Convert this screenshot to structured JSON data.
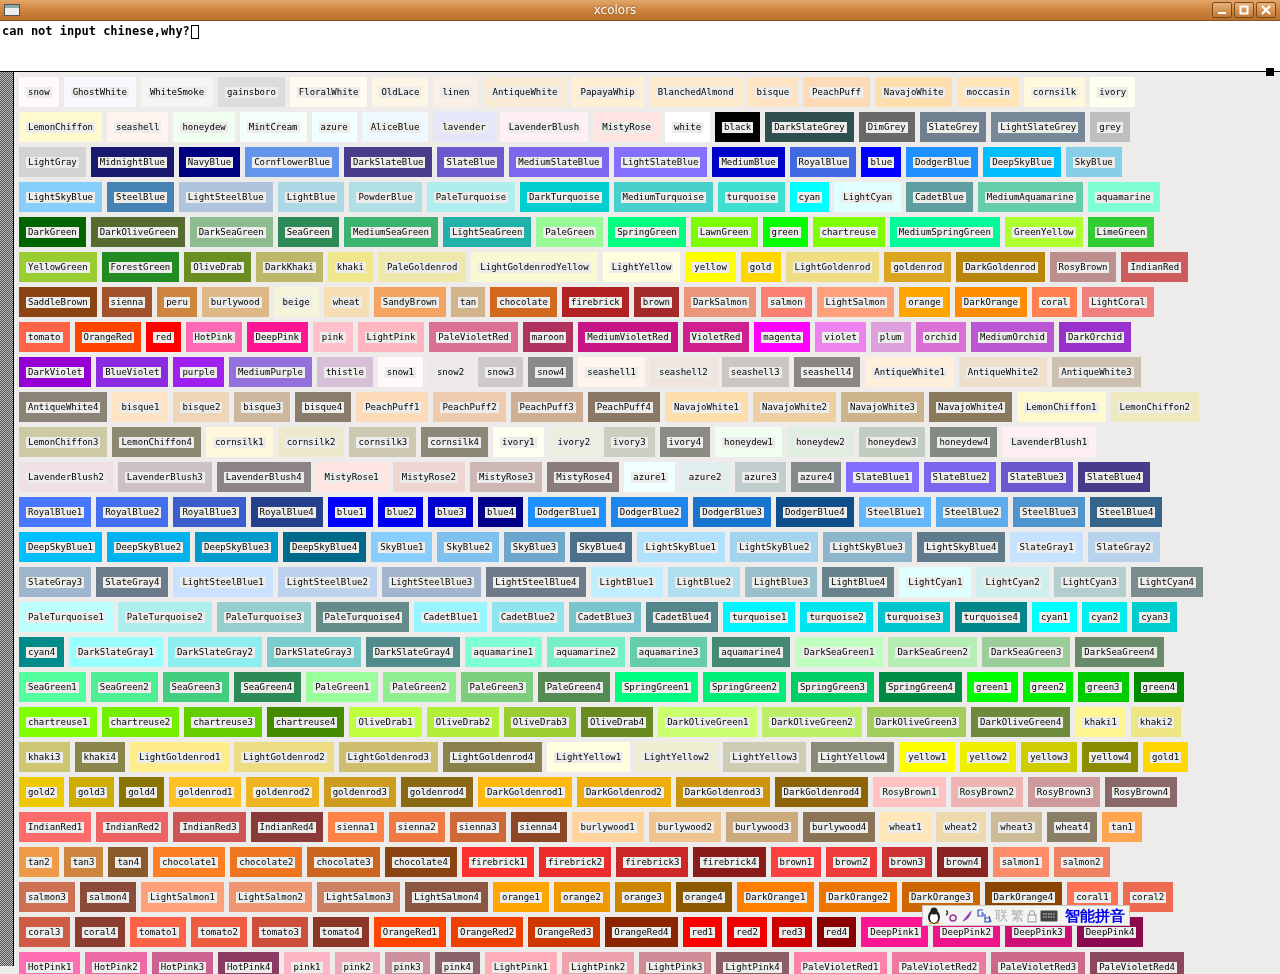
{
  "window": {
    "title": "xcolors"
  },
  "editor": {
    "text": "can not input chinese,why?"
  },
  "rows": [
    [
      {
        "name": "snow",
        "color": "#fffafa"
      },
      {
        "name": "GhostWhite",
        "color": "#f8f8ff"
      },
      {
        "name": "WhiteSmoke",
        "color": "#f5f5f5"
      },
      {
        "name": "gainsboro",
        "color": "#dcdcdc"
      },
      {
        "name": "FloralWhite",
        "color": "#fffaf0"
      },
      {
        "name": "OldLace",
        "color": "#fdf5e6"
      },
      {
        "name": "linen",
        "color": "#faf0e6"
      },
      {
        "name": "AntiqueWhite",
        "color": "#faebd7"
      },
      {
        "name": "PapayaWhip",
        "color": "#ffefd5"
      },
      {
        "name": "BlanchedAlmond",
        "color": "#ffebcd"
      },
      {
        "name": "bisque",
        "color": "#ffe4c4"
      },
      {
        "name": "PeachPuff",
        "color": "#ffdab9"
      },
      {
        "name": "NavajoWhite",
        "color": "#ffdead"
      },
      {
        "name": "moccasin",
        "color": "#ffe4b5"
      },
      {
        "name": "cornsilk",
        "color": "#fff8dc"
      },
      {
        "name": "ivory",
        "color": "#fffff0"
      }
    ],
    [
      {
        "name": "LemonChiffon",
        "color": "#fffacd"
      },
      {
        "name": "seashell",
        "color": "#fff5ee"
      },
      {
        "name": "honeydew",
        "color": "#f0fff0"
      },
      {
        "name": "MintCream",
        "color": "#f5fffa"
      },
      {
        "name": "azure",
        "color": "#f0ffff"
      },
      {
        "name": "AliceBlue",
        "color": "#f0f8ff"
      },
      {
        "name": "lavender",
        "color": "#e6e6fa"
      },
      {
        "name": "LavenderBlush",
        "color": "#fff0f5"
      },
      {
        "name": "MistyRose",
        "color": "#ffe4e1"
      },
      {
        "name": "white",
        "color": "#ffffff"
      },
      {
        "name": "black",
        "color": "#000000"
      },
      {
        "name": "DarkSlateGrey",
        "color": "#2f4f4f"
      },
      {
        "name": "DimGrey",
        "color": "#696969"
      },
      {
        "name": "SlateGrey",
        "color": "#708090"
      },
      {
        "name": "LightSlateGrey",
        "color": "#778899"
      },
      {
        "name": "grey",
        "color": "#bebebe"
      }
    ],
    [
      {
        "name": "LightGray",
        "color": "#d3d3d3"
      },
      {
        "name": "MidnightBlue",
        "color": "#191970"
      },
      {
        "name": "NavyBlue",
        "color": "#000080"
      },
      {
        "name": "CornflowerBlue",
        "color": "#6495ed"
      },
      {
        "name": "DarkSlateBlue",
        "color": "#483d8b"
      },
      {
        "name": "SlateBlue",
        "color": "#6a5acd"
      },
      {
        "name": "MediumSlateBlue",
        "color": "#7b68ee"
      },
      {
        "name": "LightSlateBlue",
        "color": "#8470ff"
      },
      {
        "name": "MediumBlue",
        "color": "#0000cd"
      },
      {
        "name": "RoyalBlue",
        "color": "#4169e1"
      },
      {
        "name": "blue",
        "color": "#0000ff"
      },
      {
        "name": "DodgerBlue",
        "color": "#1e90ff"
      },
      {
        "name": "DeepSkyBlue",
        "color": "#00bfff"
      },
      {
        "name": "SkyBlue",
        "color": "#87ceeb"
      }
    ],
    [
      {
        "name": "LightSkyBlue",
        "color": "#87cefa"
      },
      {
        "name": "SteelBlue",
        "color": "#4682b4"
      },
      {
        "name": "LightSteelBlue",
        "color": "#b0c4de"
      },
      {
        "name": "LightBlue",
        "color": "#add8e6"
      },
      {
        "name": "PowderBlue",
        "color": "#b0e0e6"
      },
      {
        "name": "PaleTurquoise",
        "color": "#afeeee"
      },
      {
        "name": "DarkTurquoise",
        "color": "#00ced1"
      },
      {
        "name": "MediumTurquoise",
        "color": "#48d1cc"
      },
      {
        "name": "turquoise",
        "color": "#40e0d0"
      },
      {
        "name": "cyan",
        "color": "#00ffff"
      },
      {
        "name": "LightCyan",
        "color": "#e0ffff"
      },
      {
        "name": "CadetBlue",
        "color": "#5f9ea0"
      },
      {
        "name": "MediumAquamarine",
        "color": "#66cdaa"
      },
      {
        "name": "aquamarine",
        "color": "#7fffd4"
      }
    ],
    [
      {
        "name": "DarkGreen",
        "color": "#006400"
      },
      {
        "name": "DarkOliveGreen",
        "color": "#556b2f"
      },
      {
        "name": "DarkSeaGreen",
        "color": "#8fbc8f"
      },
      {
        "name": "SeaGreen",
        "color": "#2e8b57"
      },
      {
        "name": "MediumSeaGreen",
        "color": "#3cb371"
      },
      {
        "name": "LightSeaGreen",
        "color": "#20b2aa"
      },
      {
        "name": "PaleGreen",
        "color": "#98fb98"
      },
      {
        "name": "SpringGreen",
        "color": "#00ff7f"
      },
      {
        "name": "LawnGreen",
        "color": "#7cfc00"
      },
      {
        "name": "green",
        "color": "#00ff00"
      },
      {
        "name": "chartreuse",
        "color": "#7fff00"
      },
      {
        "name": "MediumSpringGreen",
        "color": "#00fa9a"
      },
      {
        "name": "GreenYellow",
        "color": "#adff2f"
      },
      {
        "name": "LimeGreen",
        "color": "#32cd32"
      }
    ],
    [
      {
        "name": "YellowGreen",
        "color": "#9acd32"
      },
      {
        "name": "ForestGreen",
        "color": "#228b22"
      },
      {
        "name": "OliveDrab",
        "color": "#6b8e23"
      },
      {
        "name": "DarkKhaki",
        "color": "#bdb76b"
      },
      {
        "name": "khaki",
        "color": "#f0e68c"
      },
      {
        "name": "PaleGoldenrod",
        "color": "#eee8aa"
      },
      {
        "name": "LightGoldenrodYellow",
        "color": "#fafad2"
      },
      {
        "name": "LightYellow",
        "color": "#ffffe0"
      },
      {
        "name": "yellow",
        "color": "#ffff00"
      },
      {
        "name": "gold",
        "color": "#ffd700"
      },
      {
        "name": "LightGoldenrod",
        "color": "#eedd82"
      },
      {
        "name": "goldenrod",
        "color": "#daa520"
      },
      {
        "name": "DarkGoldenrod",
        "color": "#b8860b"
      },
      {
        "name": "RosyBrown",
        "color": "#bc8f8f"
      },
      {
        "name": "IndianRed",
        "color": "#cd5c5c"
      }
    ],
    [
      {
        "name": "SaddleBrown",
        "color": "#8b4513"
      },
      {
        "name": "sienna",
        "color": "#a0522d"
      },
      {
        "name": "peru",
        "color": "#cd853f"
      },
      {
        "name": "burlywood",
        "color": "#deb887"
      },
      {
        "name": "beige",
        "color": "#f5f5dc"
      },
      {
        "name": "wheat",
        "color": "#f5deb3"
      },
      {
        "name": "SandyBrown",
        "color": "#f4a460"
      },
      {
        "name": "tan",
        "color": "#d2b48c"
      },
      {
        "name": "chocolate",
        "color": "#d2691e"
      },
      {
        "name": "firebrick",
        "color": "#b22222"
      },
      {
        "name": "brown",
        "color": "#a52a2a"
      },
      {
        "name": "DarkSalmon",
        "color": "#e9967a"
      },
      {
        "name": "salmon",
        "color": "#fa8072"
      },
      {
        "name": "LightSalmon",
        "color": "#ffa07a"
      },
      {
        "name": "orange",
        "color": "#ffa500"
      },
      {
        "name": "DarkOrange",
        "color": "#ff8c00"
      },
      {
        "name": "coral",
        "color": "#ff7f50"
      },
      {
        "name": "LightCoral",
        "color": "#f08080"
      }
    ],
    [
      {
        "name": "tomato",
        "color": "#ff6347"
      },
      {
        "name": "OrangeRed",
        "color": "#ff4500"
      },
      {
        "name": "red",
        "color": "#ff0000"
      },
      {
        "name": "HotPink",
        "color": "#ff69b4"
      },
      {
        "name": "DeepPink",
        "color": "#ff1493"
      },
      {
        "name": "pink",
        "color": "#ffc0cb"
      },
      {
        "name": "LightPink",
        "color": "#ffb6c1"
      },
      {
        "name": "PaleVioletRed",
        "color": "#db7093"
      },
      {
        "name": "maroon",
        "color": "#b03060"
      },
      {
        "name": "MediumVioletRed",
        "color": "#c71585"
      },
      {
        "name": "VioletRed",
        "color": "#d02090"
      },
      {
        "name": "magenta",
        "color": "#ff00ff"
      },
      {
        "name": "violet",
        "color": "#ee82ee"
      },
      {
        "name": "plum",
        "color": "#dda0dd"
      },
      {
        "name": "orchid",
        "color": "#da70d6"
      },
      {
        "name": "MediumOrchid",
        "color": "#ba55d3"
      },
      {
        "name": "DarkOrchid",
        "color": "#9932cc"
      }
    ],
    [
      {
        "name": "DarkViolet",
        "color": "#9400d3"
      },
      {
        "name": "BlueViolet",
        "color": "#8a2be2"
      },
      {
        "name": "purple",
        "color": "#a020f0"
      },
      {
        "name": "MediumPurple",
        "color": "#9370db"
      },
      {
        "name": "thistle",
        "color": "#d8bfd8"
      },
      {
        "name": "snow1",
        "color": "#fffafa"
      },
      {
        "name": "snow2",
        "color": "#eee9e9"
      },
      {
        "name": "snow3",
        "color": "#cdc9c9"
      },
      {
        "name": "snow4",
        "color": "#8b8989"
      },
      {
        "name": "seashell1",
        "color": "#fff5ee"
      },
      {
        "name": "seashell2",
        "color": "#eee5de"
      },
      {
        "name": "seashell3",
        "color": "#cdc5bf"
      },
      {
        "name": "seashell4",
        "color": "#8b8682"
      },
      {
        "name": "AntiqueWhite1",
        "color": "#ffefdb"
      },
      {
        "name": "AntiqueWhite2",
        "color": "#eedfcc"
      },
      {
        "name": "AntiqueWhite3",
        "color": "#cdc0b0"
      }
    ],
    [
      {
        "name": "AntiqueWhite4",
        "color": "#8b8378"
      },
      {
        "name": "bisque1",
        "color": "#ffe4c4"
      },
      {
        "name": "bisque2",
        "color": "#eed5b7"
      },
      {
        "name": "bisque3",
        "color": "#cdb79e"
      },
      {
        "name": "bisque4",
        "color": "#8b7d6b"
      },
      {
        "name": "PeachPuff1",
        "color": "#ffdab9"
      },
      {
        "name": "PeachPuff2",
        "color": "#eecbad"
      },
      {
        "name": "PeachPuff3",
        "color": "#cdaf95"
      },
      {
        "name": "PeachPuff4",
        "color": "#8b7765"
      },
      {
        "name": "NavajoWhite1",
        "color": "#ffdead"
      },
      {
        "name": "NavajoWhite2",
        "color": "#eecfa1"
      },
      {
        "name": "NavajoWhite3",
        "color": "#cdb38b"
      },
      {
        "name": "NavajoWhite4",
        "color": "#8b795e"
      },
      {
        "name": "LemonChiffon1",
        "color": "#fffacd"
      },
      {
        "name": "LemonChiffon2",
        "color": "#eee9bf"
      }
    ],
    [
      {
        "name": "LemonChiffon3",
        "color": "#cdc9a5"
      },
      {
        "name": "LemonChiffon4",
        "color": "#8b8970"
      },
      {
        "name": "cornsilk1",
        "color": "#fff8dc"
      },
      {
        "name": "cornsilk2",
        "color": "#eee8cd"
      },
      {
        "name": "cornsilk3",
        "color": "#cdc8b1"
      },
      {
        "name": "cornsilk4",
        "color": "#8b8878"
      },
      {
        "name": "ivory1",
        "color": "#fffff0"
      },
      {
        "name": "ivory2",
        "color": "#eeeee0"
      },
      {
        "name": "ivory3",
        "color": "#cdcdc1"
      },
      {
        "name": "ivory4",
        "color": "#8b8b83"
      },
      {
        "name": "honeydew1",
        "color": "#f0fff0"
      },
      {
        "name": "honeydew2",
        "color": "#e0eee0"
      },
      {
        "name": "honeydew3",
        "color": "#c1cdc1"
      },
      {
        "name": "honeydew4",
        "color": "#838b83"
      },
      {
        "name": "LavenderBlush1",
        "color": "#fff0f5"
      }
    ],
    [
      {
        "name": "LavenderBlush2",
        "color": "#eee0e5"
      },
      {
        "name": "LavenderBlush3",
        "color": "#cdc1c5"
      },
      {
        "name": "LavenderBlush4",
        "color": "#8b8386"
      },
      {
        "name": "MistyRose1",
        "color": "#ffe4e1"
      },
      {
        "name": "MistyRose2",
        "color": "#eed5d2"
      },
      {
        "name": "MistyRose3",
        "color": "#cdb7b5"
      },
      {
        "name": "MistyRose4",
        "color": "#8b7d7b"
      },
      {
        "name": "azure1",
        "color": "#f0ffff"
      },
      {
        "name": "azure2",
        "color": "#e0eeee"
      },
      {
        "name": "azure3",
        "color": "#c1cdcd"
      },
      {
        "name": "azure4",
        "color": "#838b8b"
      },
      {
        "name": "SlateBlue1",
        "color": "#836fff"
      },
      {
        "name": "SlateBlue2",
        "color": "#7a67ee"
      },
      {
        "name": "SlateBlue3",
        "color": "#6959cd"
      },
      {
        "name": "SlateBlue4",
        "color": "#473c8b"
      }
    ],
    [
      {
        "name": "RoyalBlue1",
        "color": "#4876ff"
      },
      {
        "name": "RoyalBlue2",
        "color": "#436eee"
      },
      {
        "name": "RoyalBlue3",
        "color": "#3a5fcd"
      },
      {
        "name": "RoyalBlue4",
        "color": "#27408b"
      },
      {
        "name": "blue1",
        "color": "#0000ff"
      },
      {
        "name": "blue2",
        "color": "#0000ee"
      },
      {
        "name": "blue3",
        "color": "#0000cd"
      },
      {
        "name": "blue4",
        "color": "#00008b"
      },
      {
        "name": "DodgerBlue1",
        "color": "#1e90ff"
      },
      {
        "name": "DodgerBlue2",
        "color": "#1c86ee"
      },
      {
        "name": "DodgerBlue3",
        "color": "#1874cd"
      },
      {
        "name": "DodgerBlue4",
        "color": "#104e8b"
      },
      {
        "name": "SteelBlue1",
        "color": "#63b8ff"
      },
      {
        "name": "SteelBlue2",
        "color": "#5cacee"
      },
      {
        "name": "SteelBlue3",
        "color": "#4f94cd"
      },
      {
        "name": "SteelBlue4",
        "color": "#36648b"
      }
    ],
    [
      {
        "name": "DeepSkyBlue1",
        "color": "#00bfff"
      },
      {
        "name": "DeepSkyBlue2",
        "color": "#00b2ee"
      },
      {
        "name": "DeepSkyBlue3",
        "color": "#009acd"
      },
      {
        "name": "DeepSkyBlue4",
        "color": "#00688b"
      },
      {
        "name": "SkyBlue1",
        "color": "#87ceff"
      },
      {
        "name": "SkyBlue2",
        "color": "#7ec0ee"
      },
      {
        "name": "SkyBlue3",
        "color": "#6ca6cd"
      },
      {
        "name": "SkyBlue4",
        "color": "#4a708b"
      },
      {
        "name": "LightSkyBlue1",
        "color": "#b0e2ff"
      },
      {
        "name": "LightSkyBlue2",
        "color": "#a4d3ee"
      },
      {
        "name": "LightSkyBlue3",
        "color": "#8db6cd"
      },
      {
        "name": "LightSkyBlue4",
        "color": "#607b8b"
      },
      {
        "name": "SlateGray1",
        "color": "#c6e2ff"
      },
      {
        "name": "SlateGray2",
        "color": "#b9d3ee"
      }
    ],
    [
      {
        "name": "SlateGray3",
        "color": "#9fb6cd"
      },
      {
        "name": "SlateGray4",
        "color": "#6c7b8b"
      },
      {
        "name": "LightSteelBlue1",
        "color": "#cae1ff"
      },
      {
        "name": "LightSteelBlue2",
        "color": "#bcd2ee"
      },
      {
        "name": "LightSteelBlue3",
        "color": "#a2b5cd"
      },
      {
        "name": "LightSteelBlue4",
        "color": "#6e7b8b"
      },
      {
        "name": "LightBlue1",
        "color": "#bfefff"
      },
      {
        "name": "LightBlue2",
        "color": "#b2dfee"
      },
      {
        "name": "LightBlue3",
        "color": "#9ac0cd"
      },
      {
        "name": "LightBlue4",
        "color": "#68838b"
      },
      {
        "name": "LightCyan1",
        "color": "#e0ffff"
      },
      {
        "name": "LightCyan2",
        "color": "#d1eeee"
      },
      {
        "name": "LightCyan3",
        "color": "#b4cdcd"
      },
      {
        "name": "LightCyan4",
        "color": "#7a8b8b"
      }
    ],
    [
      {
        "name": "PaleTurquoise1",
        "color": "#bbffff"
      },
      {
        "name": "PaleTurquoise2",
        "color": "#aeeeee"
      },
      {
        "name": "PaleTurquoise3",
        "color": "#96cdcd"
      },
      {
        "name": "PaleTurquoise4",
        "color": "#668b8b"
      },
      {
        "name": "CadetBlue1",
        "color": "#98f5ff"
      },
      {
        "name": "CadetBlue2",
        "color": "#8ee5ee"
      },
      {
        "name": "CadetBlue3",
        "color": "#7ac5cd"
      },
      {
        "name": "CadetBlue4",
        "color": "#53868b"
      },
      {
        "name": "turquoise1",
        "color": "#00f5ff"
      },
      {
        "name": "turquoise2",
        "color": "#00e5ee"
      },
      {
        "name": "turquoise3",
        "color": "#00c5cd"
      },
      {
        "name": "turquoise4",
        "color": "#00868b"
      },
      {
        "name": "cyan1",
        "color": "#00ffff"
      },
      {
        "name": "cyan2",
        "color": "#00eeee"
      },
      {
        "name": "cyan3",
        "color": "#00cdcd"
      }
    ],
    [
      {
        "name": "cyan4",
        "color": "#008b8b"
      },
      {
        "name": "DarkSlateGray1",
        "color": "#97ffff"
      },
      {
        "name": "DarkSlateGray2",
        "color": "#8deeee"
      },
      {
        "name": "DarkSlateGray3",
        "color": "#79cdcd"
      },
      {
        "name": "DarkSlateGray4",
        "color": "#528b8b"
      },
      {
        "name": "aquamarine1",
        "color": "#7fffd4"
      },
      {
        "name": "aquamarine2",
        "color": "#76eec6"
      },
      {
        "name": "aquamarine3",
        "color": "#66cdaa"
      },
      {
        "name": "aquamarine4",
        "color": "#458b74"
      },
      {
        "name": "DarkSeaGreen1",
        "color": "#c1ffc1"
      },
      {
        "name": "DarkSeaGreen2",
        "color": "#b4eeb4"
      },
      {
        "name": "DarkSeaGreen3",
        "color": "#9bcd9b"
      },
      {
        "name": "DarkSeaGreen4",
        "color": "#698b69"
      }
    ],
    [
      {
        "name": "SeaGreen1",
        "color": "#54ff9f"
      },
      {
        "name": "SeaGreen2",
        "color": "#4eee94"
      },
      {
        "name": "SeaGreen3",
        "color": "#43cd80"
      },
      {
        "name": "SeaGreen4",
        "color": "#2e8b57"
      },
      {
        "name": "PaleGreen1",
        "color": "#9aff9a"
      },
      {
        "name": "PaleGreen2",
        "color": "#90ee90"
      },
      {
        "name": "PaleGreen3",
        "color": "#7ccd7c"
      },
      {
        "name": "PaleGreen4",
        "color": "#548b54"
      },
      {
        "name": "SpringGreen1",
        "color": "#00ff7f"
      },
      {
        "name": "SpringGreen2",
        "color": "#00ee76"
      },
      {
        "name": "SpringGreen3",
        "color": "#00cd66"
      },
      {
        "name": "SpringGreen4",
        "color": "#008b45"
      },
      {
        "name": "green1",
        "color": "#00ff00"
      },
      {
        "name": "green2",
        "color": "#00ee00"
      },
      {
        "name": "green3",
        "color": "#00cd00"
      },
      {
        "name": "green4",
        "color": "#008b00"
      }
    ],
    [
      {
        "name": "chartreuse1",
        "color": "#7fff00"
      },
      {
        "name": "chartreuse2",
        "color": "#76ee00"
      },
      {
        "name": "chartreuse3",
        "color": "#66cd00"
      },
      {
        "name": "chartreuse4",
        "color": "#458b00"
      },
      {
        "name": "OliveDrab1",
        "color": "#c0ff3e"
      },
      {
        "name": "OliveDrab2",
        "color": "#b3ee3a"
      },
      {
        "name": "OliveDrab3",
        "color": "#9acd32"
      },
      {
        "name": "OliveDrab4",
        "color": "#698b22"
      },
      {
        "name": "DarkOliveGreen1",
        "color": "#caff70"
      },
      {
        "name": "DarkOliveGreen2",
        "color": "#bcee68"
      },
      {
        "name": "DarkOliveGreen3",
        "color": "#a2cd5a"
      },
      {
        "name": "DarkOliveGreen4",
        "color": "#6e8b3d"
      },
      {
        "name": "khaki1",
        "color": "#fff68f"
      },
      {
        "name": "khaki2",
        "color": "#eee685"
      }
    ],
    [
      {
        "name": "khaki3",
        "color": "#cdc673"
      },
      {
        "name": "khaki4",
        "color": "#8b864e"
      },
      {
        "name": "LightGoldenrod1",
        "color": "#ffec8b"
      },
      {
        "name": "LightGoldenrod2",
        "color": "#eedc82"
      },
      {
        "name": "LightGoldenrod3",
        "color": "#cdbe70"
      },
      {
        "name": "LightGoldenrod4",
        "color": "#8b814c"
      },
      {
        "name": "LightYellow1",
        "color": "#ffffe0"
      },
      {
        "name": "LightYellow2",
        "color": "#eeeed1"
      },
      {
        "name": "LightYellow3",
        "color": "#cdcdb4"
      },
      {
        "name": "LightYellow4",
        "color": "#8b8b7a"
      },
      {
        "name": "yellow1",
        "color": "#ffff00"
      },
      {
        "name": "yellow2",
        "color": "#eeee00"
      },
      {
        "name": "yellow3",
        "color": "#cdcd00"
      },
      {
        "name": "yellow4",
        "color": "#8b8b00"
      },
      {
        "name": "gold1",
        "color": "#ffd700"
      }
    ],
    [
      {
        "name": "gold2",
        "color": "#eec900"
      },
      {
        "name": "gold3",
        "color": "#cdad00"
      },
      {
        "name": "gold4",
        "color": "#8b7500"
      },
      {
        "name": "goldenrod1",
        "color": "#ffc125"
      },
      {
        "name": "goldenrod2",
        "color": "#eeb422"
      },
      {
        "name": "goldenrod3",
        "color": "#cd9b1d"
      },
      {
        "name": "goldenrod4",
        "color": "#8b6914"
      },
      {
        "name": "DarkGoldenrod1",
        "color": "#ffb90f"
      },
      {
        "name": "DarkGoldenrod2",
        "color": "#eead0e"
      },
      {
        "name": "DarkGoldenrod3",
        "color": "#cd950c"
      },
      {
        "name": "DarkGoldenrod4",
        "color": "#8b6508"
      },
      {
        "name": "RosyBrown1",
        "color": "#ffc1c1"
      },
      {
        "name": "RosyBrown2",
        "color": "#eeb4b4"
      },
      {
        "name": "RosyBrown3",
        "color": "#cd9b9b"
      },
      {
        "name": "RosyBrown4",
        "color": "#8b6969"
      }
    ],
    [
      {
        "name": "IndianRed1",
        "color": "#ff6a6a"
      },
      {
        "name": "IndianRed2",
        "color": "#ee6363"
      },
      {
        "name": "IndianRed3",
        "color": "#cd5555"
      },
      {
        "name": "IndianRed4",
        "color": "#8b3a3a"
      },
      {
        "name": "sienna1",
        "color": "#ff8247"
      },
      {
        "name": "sienna2",
        "color": "#ee7942"
      },
      {
        "name": "sienna3",
        "color": "#cd6839"
      },
      {
        "name": "sienna4",
        "color": "#8b4726"
      },
      {
        "name": "burlywood1",
        "color": "#ffd39b"
      },
      {
        "name": "burlywood2",
        "color": "#eec591"
      },
      {
        "name": "burlywood3",
        "color": "#cdaa7d"
      },
      {
        "name": "burlywood4",
        "color": "#8b7355"
      },
      {
        "name": "wheat1",
        "color": "#ffe7ba"
      },
      {
        "name": "wheat2",
        "color": "#eed8ae"
      },
      {
        "name": "wheat3",
        "color": "#cdba96"
      },
      {
        "name": "wheat4",
        "color": "#8b7e66"
      },
      {
        "name": "tan1",
        "color": "#ffa54f"
      }
    ],
    [
      {
        "name": "tan2",
        "color": "#ee9a49"
      },
      {
        "name": "tan3",
        "color": "#cd853f"
      },
      {
        "name": "tan4",
        "color": "#8b5a2b"
      },
      {
        "name": "chocolate1",
        "color": "#ff7f24"
      },
      {
        "name": "chocolate2",
        "color": "#ee7621"
      },
      {
        "name": "chocolate3",
        "color": "#cd661d"
      },
      {
        "name": "chocolate4",
        "color": "#8b4513"
      },
      {
        "name": "firebrick1",
        "color": "#ff3030"
      },
      {
        "name": "firebrick2",
        "color": "#ee2c2c"
      },
      {
        "name": "firebrick3",
        "color": "#cd2626"
      },
      {
        "name": "firebrick4",
        "color": "#8b1a1a"
      },
      {
        "name": "brown1",
        "color": "#ff4040"
      },
      {
        "name": "brown2",
        "color": "#ee3b3b"
      },
      {
        "name": "brown3",
        "color": "#cd3333"
      },
      {
        "name": "brown4",
        "color": "#8b2323"
      },
      {
        "name": "salmon1",
        "color": "#ff8c69"
      },
      {
        "name": "salmon2",
        "color": "#ee8262"
      }
    ],
    [
      {
        "name": "salmon3",
        "color": "#cd7054"
      },
      {
        "name": "salmon4",
        "color": "#8b4c39"
      },
      {
        "name": "LightSalmon1",
        "color": "#ffa07a"
      },
      {
        "name": "LightSalmon2",
        "color": "#ee9572"
      },
      {
        "name": "LightSalmon3",
        "color": "#cd8162"
      },
      {
        "name": "LightSalmon4",
        "color": "#8b5742"
      },
      {
        "name": "orange1",
        "color": "#ffa500"
      },
      {
        "name": "orange2",
        "color": "#ee9a00"
      },
      {
        "name": "orange3",
        "color": "#cd8500"
      },
      {
        "name": "orange4",
        "color": "#8b5a00"
      },
      {
        "name": "DarkOrange1",
        "color": "#ff7f00"
      },
      {
        "name": "DarkOrange2",
        "color": "#ee7600"
      },
      {
        "name": "DarkOrange3",
        "color": "#cd6600"
      },
      {
        "name": "DarkOrange4",
        "color": "#8b4500"
      },
      {
        "name": "coral1",
        "color": "#ff7256"
      },
      {
        "name": "coral2",
        "color": "#ee6a50"
      }
    ],
    [
      {
        "name": "coral3",
        "color": "#cd5b45"
      },
      {
        "name": "coral4",
        "color": "#8b3e2f"
      },
      {
        "name": "tomato1",
        "color": "#ff6347"
      },
      {
        "name": "tomato2",
        "color": "#ee5c42"
      },
      {
        "name": "tomato3",
        "color": "#cd4f39"
      },
      {
        "name": "tomato4",
        "color": "#8b3626"
      },
      {
        "name": "OrangeRed1",
        "color": "#ff4500"
      },
      {
        "name": "OrangeRed2",
        "color": "#ee4000"
      },
      {
        "name": "OrangeRed3",
        "color": "#cd3700"
      },
      {
        "name": "OrangeRed4",
        "color": "#8b2500"
      },
      {
        "name": "red1",
        "color": "#ff0000"
      },
      {
        "name": "red2",
        "color": "#ee0000"
      },
      {
        "name": "red3",
        "color": "#cd0000"
      },
      {
        "name": "red4",
        "color": "#8b0000"
      },
      {
        "name": "DeepPink1",
        "color": "#ff1493"
      },
      {
        "name": "DeepPink2",
        "color": "#ee1289"
      },
      {
        "name": "DeepPink3",
        "color": "#cd1076"
      },
      {
        "name": "DeepPink4",
        "color": "#8b0a50"
      }
    ],
    [
      {
        "name": "HotPink1",
        "color": "#ff6eb4"
      },
      {
        "name": "HotPink2",
        "color": "#ee6aa7"
      },
      {
        "name": "HotPink3",
        "color": "#cd6090"
      },
      {
        "name": "HotPink4",
        "color": "#8b3a62"
      },
      {
        "name": "pink1",
        "color": "#ffb5c5"
      },
      {
        "name": "pink2",
        "color": "#eea9b8"
      },
      {
        "name": "pink3",
        "color": "#cd919e"
      },
      {
        "name": "pink4",
        "color": "#8b636c"
      },
      {
        "name": "LightPink1",
        "color": "#ffaeb9"
      },
      {
        "name": "LightPink2",
        "color": "#eea2ad"
      },
      {
        "name": "LightPink3",
        "color": "#cd8c95"
      },
      {
        "name": "LightPink4",
        "color": "#8b5f65"
      },
      {
        "name": "PaleVioletRed1",
        "color": "#ff82ab"
      },
      {
        "name": "PaleVioletRed2",
        "color": "#ee799f"
      },
      {
        "name": "PaleVioletRed3",
        "color": "#cd6889"
      },
      {
        "name": "PaleVioletRed4",
        "color": "#8b475d"
      }
    ]
  ],
  "ime_toolbar": {
    "buttons": [
      {
        "label": "联",
        "disabled": true
      },
      {
        "label": "繁",
        "disabled": true
      }
    ],
    "mode": "智能拼音"
  }
}
